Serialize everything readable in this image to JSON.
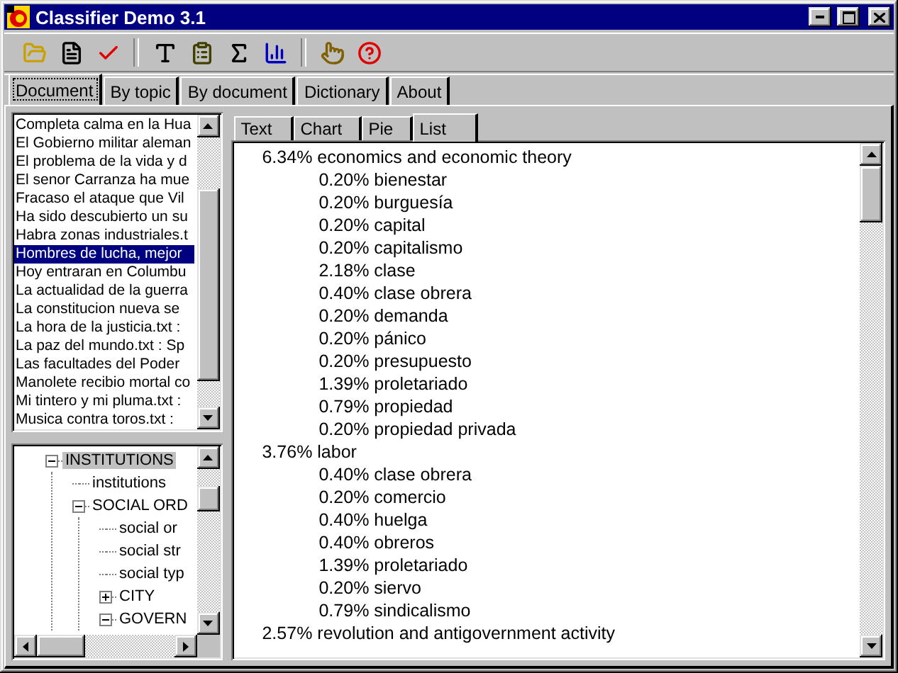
{
  "window": {
    "title": "Classifier Demo 3.1"
  },
  "tabs": [
    {
      "label": "Document",
      "selected": true
    },
    {
      "label": "By topic",
      "selected": false
    },
    {
      "label": "By document",
      "selected": false
    },
    {
      "label": "Dictionary",
      "selected": false
    },
    {
      "label": "About",
      "selected": false
    }
  ],
  "documents": [
    {
      "label": "Completa calma en la Hua",
      "selected": false
    },
    {
      "label": "El Gobierno militar aleman",
      "selected": false
    },
    {
      "label": "El problema de la vida y d",
      "selected": false
    },
    {
      "label": "El senor Carranza ha mue",
      "selected": false
    },
    {
      "label": "Fracaso el ataque que Vil",
      "selected": false
    },
    {
      "label": "Ha sido descubierto un su",
      "selected": false
    },
    {
      "label": "Habra zonas industriales.t",
      "selected": false
    },
    {
      "label": "Hombres de lucha, mejor",
      "selected": true
    },
    {
      "label": "Hoy entraran en Columbu",
      "selected": false
    },
    {
      "label": "La actualidad de la guerra",
      "selected": false
    },
    {
      "label": "La constitucion nueva se",
      "selected": false
    },
    {
      "label": "La hora de la justicia.txt :",
      "selected": false
    },
    {
      "label": "La paz del mundo.txt : Sp",
      "selected": false
    },
    {
      "label": "Las facultades del Poder",
      "selected": false
    },
    {
      "label": "Manolete recibio mortal co",
      "selected": false
    },
    {
      "label": "Mi tintero y mi pluma.txt :",
      "selected": false
    },
    {
      "label": "Musica contra toros.txt :",
      "selected": false
    }
  ],
  "tree": [
    {
      "label": "INSTITUTIONS",
      "expanded": true,
      "selected": true,
      "children": [
        {
          "label": "institutions",
          "selected": false
        },
        {
          "label": "SOCIAL ORD",
          "expanded": true,
          "selected": false,
          "children": [
            {
              "label": "social or",
              "selected": false
            },
            {
              "label": "social str",
              "selected": false
            },
            {
              "label": "social typ",
              "selected": false
            },
            {
              "label": "CITY",
              "expanded": false,
              "selected": false
            },
            {
              "label": "GOVERN",
              "expanded": true,
              "selected": false
            }
          ]
        }
      ]
    }
  ],
  "view_tabs": [
    {
      "label": "Text",
      "selected": false
    },
    {
      "label": "Chart",
      "selected": false
    },
    {
      "label": "Pie",
      "selected": false
    },
    {
      "label": "List",
      "selected": true
    }
  ],
  "topics": [
    {
      "text": "6.34% economics and economic theory",
      "children": [
        {
          "text": "0.20% bienestar"
        },
        {
          "text": "0.20% burguesía"
        },
        {
          "text": "0.20% capital"
        },
        {
          "text": "0.20% capitalismo"
        },
        {
          "text": "2.18% clase"
        },
        {
          "text": "0.40% clase obrera"
        },
        {
          "text": "0.20% demanda"
        },
        {
          "text": "0.20% pánico"
        },
        {
          "text": "0.20% presupuesto"
        },
        {
          "text": "1.39% proletariado"
        },
        {
          "text": "0.79% propiedad"
        },
        {
          "text": "0.20% propiedad privada"
        }
      ]
    },
    {
      "text": "3.76% labor",
      "children": [
        {
          "text": "0.40% clase obrera"
        },
        {
          "text": "0.20% comercio"
        },
        {
          "text": "0.40% huelga"
        },
        {
          "text": "0.40% obreros"
        },
        {
          "text": "1.39% proletariado"
        },
        {
          "text": "0.20% siervo"
        },
        {
          "text": "0.79% sindicalismo"
        }
      ]
    },
    {
      "text": "2.57% revolution and antigovernment activity"
    }
  ]
}
